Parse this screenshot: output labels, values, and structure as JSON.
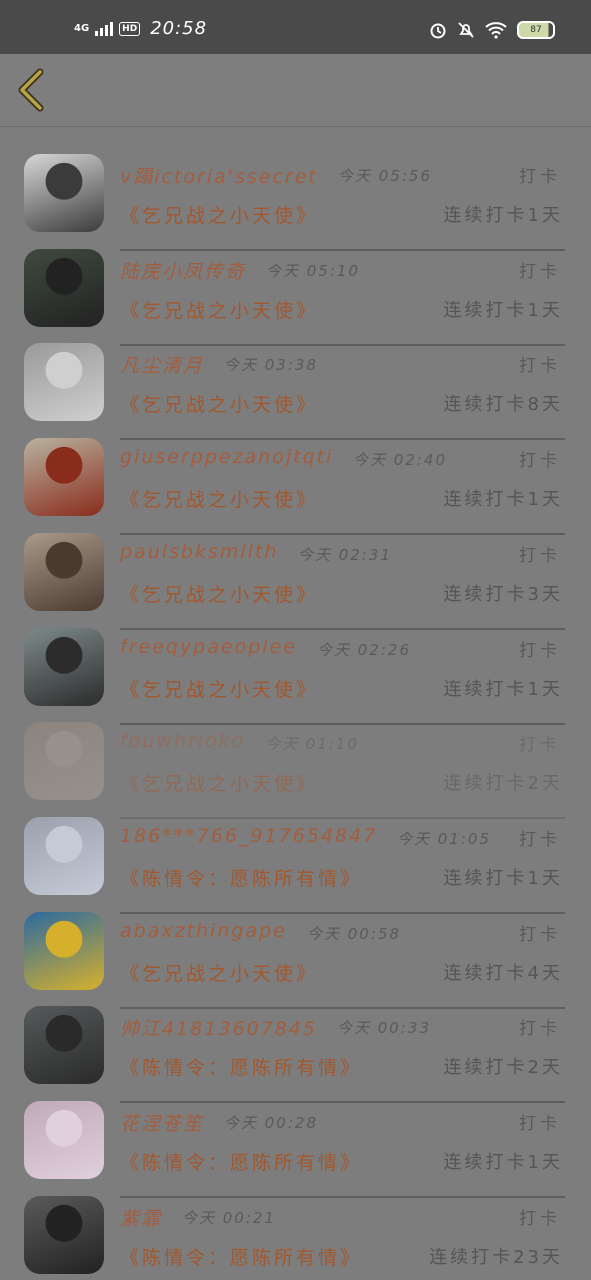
{
  "statusbar": {
    "network": "4G",
    "hd": "HD",
    "time": "20:58",
    "battery": "87"
  },
  "nav": {
    "back_icon": "chevron-left-icon"
  },
  "records": [
    {
      "name": "v蹋ictoria'ssecret",
      "time": "今天 05:56",
      "action": "打卡",
      "book": "《乞兄战之小天使》",
      "streak": "连续打卡1天",
      "avatar_colors": [
        "#d8d8d8",
        "#3b3b3b"
      ]
    },
    {
      "name": "陆庑小凤传奇",
      "time": "今天 05:10",
      "action": "打卡",
      "book": "《乞兄战之小天使》",
      "streak": "连续打卡1天",
      "avatar_colors": [
        "#3f4a3f",
        "#222"
      ]
    },
    {
      "name": "凡尘清月",
      "time": "今天 03:38",
      "action": "打卡",
      "book": "《乞兄战之小天使》",
      "streak": "连续打卡8天",
      "avatar_colors": [
        "#9a9a9a",
        "#cfcfcf"
      ]
    },
    {
      "name": "giuserppezanojtqti",
      "time": "今天 02:40",
      "action": "打卡",
      "book": "《乞兄战之小天使》",
      "streak": "连续打卡1天",
      "avatar_colors": [
        "#b9b2a0",
        "#8a2c1c"
      ]
    },
    {
      "name": "paulsbksmilth",
      "time": "今天 02:31",
      "action": "打卡",
      "book": "《乞兄战之小天使》",
      "streak": "连续打卡3天",
      "avatar_colors": [
        "#aa9a8a",
        "#4b3a30"
      ]
    },
    {
      "name": "freeqypaeoplee",
      "time": "今天 02:26",
      "action": "打卡",
      "book": "《乞兄战之小天使》",
      "streak": "连续打卡1天",
      "avatar_colors": [
        "#7d8a8a",
        "#2c2c2c"
      ]
    },
    {
      "name": "fouwhrioko",
      "time": "今天 01:10",
      "action": "打卡",
      "book": "《乞兄战之小天使》",
      "streak": "连续打卡2天",
      "avatar_colors": [
        "#9a8a80",
        "#b4a59a"
      ],
      "faded": true
    },
    {
      "name": "186***766_917654847",
      "time": "今天 01:05",
      "action": "打卡",
      "book": "《陈情令：愿陈所有情》",
      "streak": "连续打卡1天",
      "avatar_colors": [
        "#9aa0ac",
        "#c4cad6"
      ]
    },
    {
      "name": "abaxzthingape",
      "time": "今天 00:58",
      "action": "打卡",
      "book": "《乞兄战之小天使》",
      "streak": "连续打卡4天",
      "avatar_colors": [
        "#2c6aa0",
        "#d6b02c"
      ]
    },
    {
      "name": "帅江41813607845",
      "time": "今天 00:33",
      "action": "打卡",
      "book": "《陈情令：愿陈所有情》",
      "streak": "连续打卡2天",
      "avatar_colors": [
        "#555a5a",
        "#2a2a2a"
      ]
    },
    {
      "name": "花涅苍笙",
      "time": "今天 00:28",
      "action": "打卡",
      "book": "《陈情令：愿陈所有情》",
      "streak": "连续打卡1天",
      "avatar_colors": [
        "#c0aab8",
        "#e0d0dc"
      ]
    },
    {
      "name": "紫霏",
      "time": "今天 00:21",
      "action": "打卡",
      "book": "《陈情令：愿陈所有情》",
      "streak": "连续打卡23天",
      "avatar_colors": [
        "#5a5a5a",
        "#222"
      ]
    }
  ]
}
